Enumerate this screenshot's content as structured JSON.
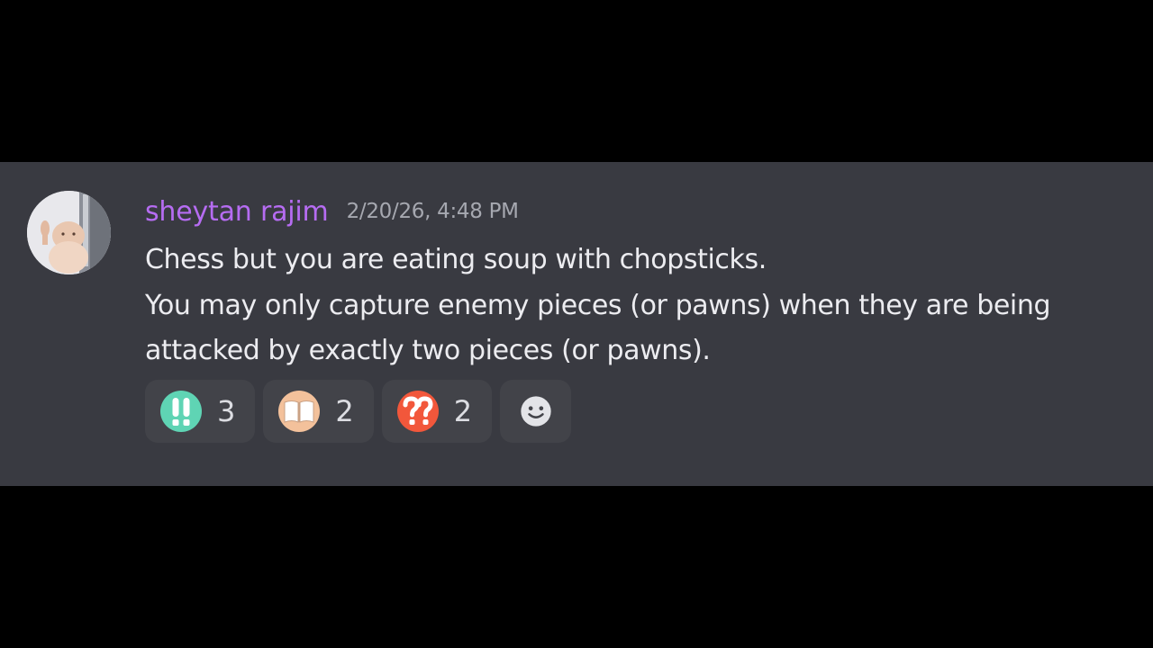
{
  "message": {
    "author": {
      "username": "sheytan rajim",
      "name_color": "#b66cf2"
    },
    "timestamp": "2/20/26, 4:48 PM",
    "content_lines": [
      "Chess but you are eating soup with chopsticks.",
      "You may only capture enemy pieces (or pawns) when they are being",
      "attacked by exactly two pieces (or pawns)."
    ],
    "reactions": [
      {
        "emoji": "double-exclamation-icon",
        "count": "3",
        "color": "#5fd4b4"
      },
      {
        "emoji": "open-book-icon",
        "count": "2",
        "color": "#f3c19b"
      },
      {
        "emoji": "double-question-icon",
        "count": "2",
        "color": "#f2573b"
      }
    ],
    "add_reaction": {
      "icon": "smiley-add-reaction-icon"
    }
  },
  "colors": {
    "background": "#000000",
    "panel": "#393a41",
    "reaction_bg": "#424349",
    "text": "#ececf0",
    "timestamp": "#a6a8b0"
  }
}
